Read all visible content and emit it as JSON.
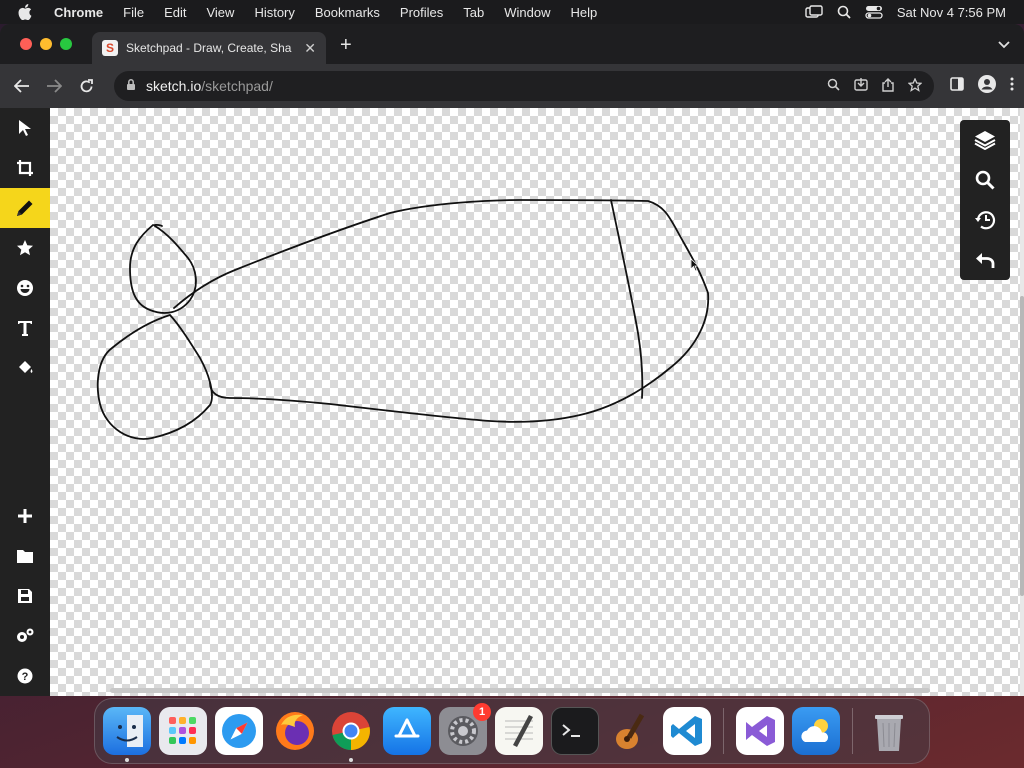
{
  "menubar": {
    "app_name": "Chrome",
    "items": [
      "File",
      "Edit",
      "View",
      "History",
      "Bookmarks",
      "Profiles",
      "Tab",
      "Window",
      "Help"
    ],
    "clock": "Sat Nov 4  7:56 PM"
  },
  "browser": {
    "tab_title": "Sketchpad - Draw, Create, Sha",
    "url_host": "sketch.io",
    "url_path": "/sketchpad/"
  },
  "left_toolbar": {
    "tools": [
      "select-tool",
      "crop-tool",
      "pencil-tool",
      "stamp-tool",
      "emoji-tool",
      "text-tool",
      "fill-tool"
    ],
    "active_tool": "pencil-tool",
    "bottom": [
      "new",
      "open",
      "save",
      "settings",
      "help"
    ]
  },
  "right_panel": {
    "buttons": [
      "layers",
      "zoom",
      "history",
      "undo"
    ]
  },
  "dock": {
    "apps": [
      "Finder",
      "Launchpad",
      "Safari",
      "Firefox",
      "Chrome",
      "App Store",
      "System Settings",
      "TextEdit",
      "Terminal",
      "GarageBand",
      "Visual Studio Code",
      "Visual Studio",
      "Weather",
      "Trash"
    ],
    "system_settings_badge": "1"
  },
  "colors": {
    "active_tool": "#f5d61b",
    "toolbar_bg": "#222222"
  }
}
